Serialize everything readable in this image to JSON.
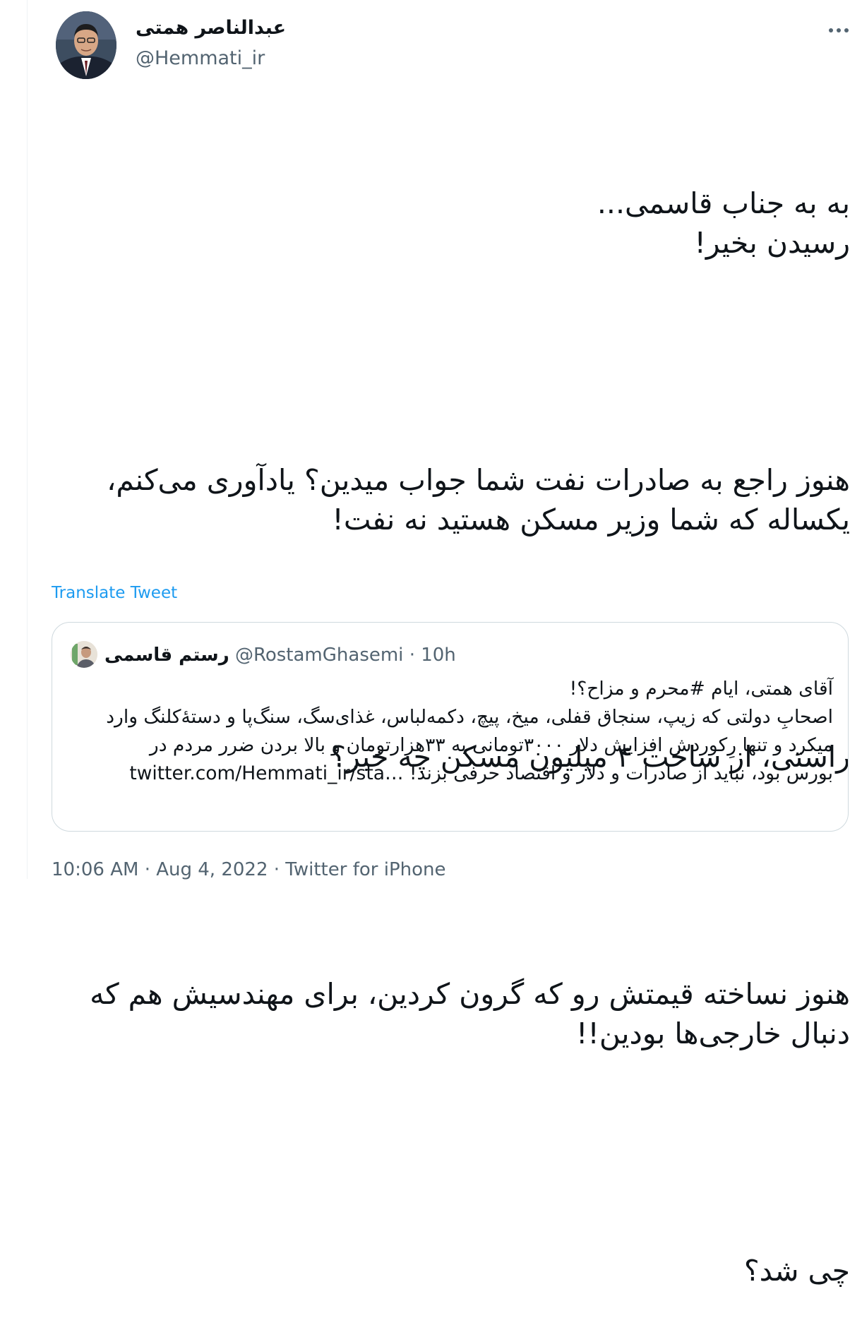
{
  "author": {
    "display_name": "عبدالناصر همتی",
    "handle": "@Hemmati_ir",
    "avatar_icon": "profile-photo-man-suit"
  },
  "more_icon": "more-horizontal-icon",
  "tweet": {
    "paragraphs": [
      "به به جناب قاسمی...\nرسیدن بخیر!",
      "هنوز راجع به صادرات نفت شما جواب میدین؟ یادآوری می‌کنم، یکساله که شما وزیر مسکن هستید نه نفت!",
      "راستی، از ساخت ۴ میلیون مسکن چه خبر؟",
      "هنوز نساخته قیمتش رو که گرون کردین، برای مهندسیش هم که دنبال خارجی‌ها بودین!!",
      "چی شد؟"
    ]
  },
  "translate_label": "Translate Tweet",
  "quote": {
    "display_name": "رستم قاسمی",
    "handle": "@RostamGhasemi",
    "separator": "·",
    "time": "10h",
    "text": "آقای همتی، ایام #محرم و مزاح؟!\nاصحابِ دولتی که زیپ، سنجاق قفلی، میخ، پیچ، دکمه‌لباس، غذای‌سگ، سنگ‌پا و دستهٔ‌کلنگ وارد میکرد و تنها رِکوردش افزایش دلار ۳۰۰۰تومانی به ۳۳هزارتومان و بالا بردن ضرر مردم در بورس بود، نباید از صادرات و دلار و اقتصاد حرفی بزند!",
    "link": "twitter.com/Hemmati_ir/sta…"
  },
  "meta": {
    "time": "10:06 AM",
    "separator": "·",
    "date": "Aug 4, 2022",
    "source": "Twitter for iPhone"
  },
  "colors": {
    "text": "#0f1419",
    "secondary": "#536471",
    "link": "#1d9bf0",
    "border": "#cfd9de"
  }
}
